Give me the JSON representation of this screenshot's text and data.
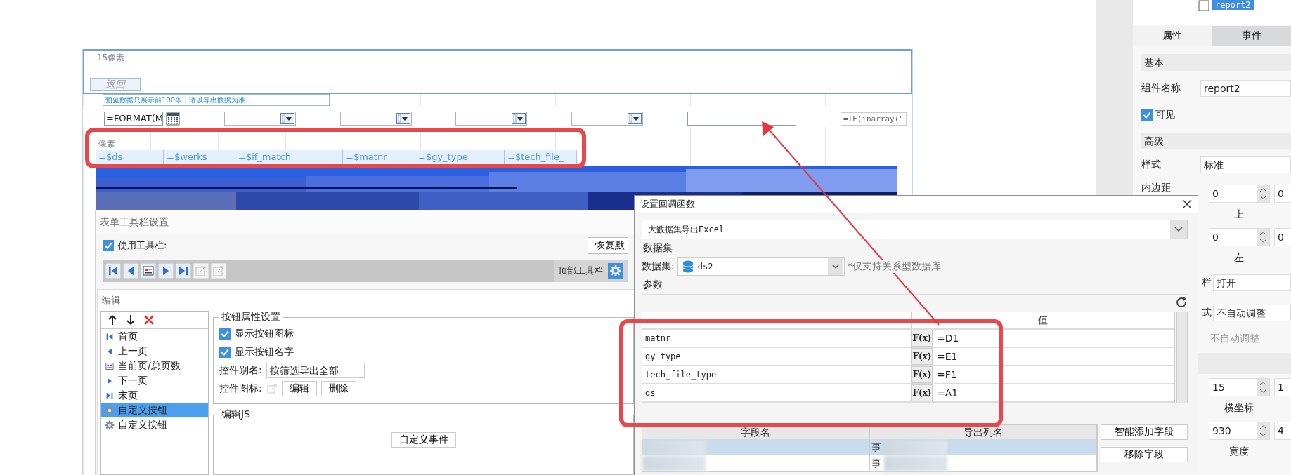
{
  "canvas": {
    "margin_label": "15像素",
    "back_button": "返回",
    "preview_note": "预览数据只展示前100条，请以导出数据为准...",
    "params": [
      {
        "kind": "date",
        "value": "=FORMAT(M"
      },
      {
        "kind": "combo"
      },
      {
        "kind": "combo"
      },
      {
        "kind": "combo"
      },
      {
        "kind": "combo"
      },
      {
        "kind": "text"
      },
      {
        "kind": "formula",
        "value": "=IF(inarray(\""
      }
    ],
    "header_label": "像素",
    "header_cells": [
      "=$ds",
      "=$werks",
      "=$if_match",
      "=$matnr",
      "=$gy_type",
      "=$tech_file_"
    ]
  },
  "toolbar_settings": {
    "title": "表单工具栏设置",
    "use_toolbar": {
      "label": "使用工具栏:",
      "checked": true
    },
    "restore_button": "恢复默",
    "position_label": "顶部工具栏",
    "edit_title": "编辑",
    "buttons": [
      {
        "kind": "first",
        "label": "首页",
        "selected": false
      },
      {
        "kind": "prev",
        "label": "上一页",
        "selected": false
      },
      {
        "kind": "page",
        "label": "当前页/总页数",
        "selected": false
      },
      {
        "kind": "next",
        "label": "下一页",
        "selected": false
      },
      {
        "kind": "last",
        "label": "末页",
        "selected": false
      },
      {
        "kind": "custom",
        "label": "自定义按钮",
        "selected": true
      },
      {
        "kind": "custom",
        "label": "自定义按钮",
        "selected": false
      }
    ],
    "props_title": "按钮属性设置",
    "show_icon": {
      "label": "显示按钮图标",
      "checked": true
    },
    "show_name": {
      "label": "显示按钮名字",
      "checked": true
    },
    "alias_label": "控件别名:",
    "alias_value": "按筛选导出全部",
    "icon_label": "控件图标:",
    "edit_button": "编辑",
    "delete_button": "删除",
    "js_title": "编辑JS",
    "event_button": "自定义事件"
  },
  "callback_dialog": {
    "title": "设置回调函数",
    "function": "大数据集导出Excel",
    "dataset_section": "数据集",
    "dataset_label": "数据集:",
    "dataset": "ds2",
    "dataset_note": "*仅支持关系型数据库",
    "params_section": "参数",
    "value_header": "值",
    "params": [
      {
        "name": "matnr",
        "fx": "F(x)",
        "value": "=D1"
      },
      {
        "name": "gy_type",
        "fx": "F(x)",
        "value": "=E1"
      },
      {
        "name": "tech_file_type",
        "fx": "F(x)",
        "value": "=F1"
      },
      {
        "name": "ds",
        "fx": "F(x)",
        "value": "=A1"
      }
    ],
    "fields_header": [
      "字段名",
      "导出列名"
    ],
    "field_rows": [
      {
        "export_name": "事",
        "selected": true
      },
      {
        "export_name": "事",
        "selected": false
      }
    ],
    "smart_add_button": "智能添加字段",
    "remove_button": "移除字段"
  },
  "properties_panel": {
    "tree_item": "report2",
    "tabs": [
      {
        "label": "属性",
        "selected": true
      },
      {
        "label": "事件",
        "selected": false
      }
    ],
    "rows": [
      {
        "kind": "section",
        "label": "基本"
      },
      {
        "kind": "text-field",
        "label": "组件名称",
        "value": "report2"
      },
      {
        "kind": "check",
        "label": "可见",
        "checked": true
      },
      {
        "kind": "section",
        "label": "高级"
      },
      {
        "kind": "text-field",
        "label": "样式",
        "value": "标准"
      },
      {
        "kind": "spin-pair",
        "label": "内边距",
        "values": [
          "0",
          "0"
        ],
        "caption": "上"
      },
      {
        "kind": "spin-pair",
        "values": [
          "0",
          "0"
        ],
        "caption": "左"
      },
      {
        "kind": "cut-field",
        "label": "栏",
        "value": "打开"
      },
      {
        "kind": "cut-field",
        "label": "式",
        "value": "不自动调整"
      },
      {
        "kind": "hint",
        "label": "不自动调整"
      },
      {
        "kind": "section"
      },
      {
        "kind": "spin-pair",
        "values": [
          "15",
          "1"
        ],
        "caption": "横坐标"
      },
      {
        "kind": "spin-pair",
        "values": [
          "930",
          "4"
        ],
        "caption": "宽度"
      }
    ]
  }
}
